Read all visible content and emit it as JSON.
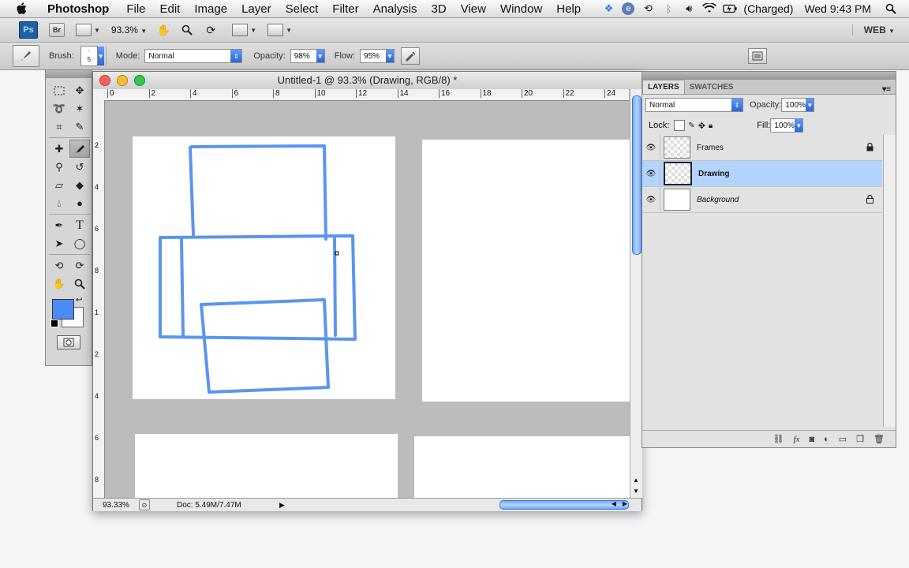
{
  "menubar": {
    "app_name": "Photoshop",
    "items": [
      "File",
      "Edit",
      "Image",
      "Layer",
      "Select",
      "Filter",
      "Analysis",
      "3D",
      "View",
      "Window",
      "Help"
    ],
    "battery": "(Charged)",
    "clock": "Wed 9:43 PM"
  },
  "appbar": {
    "ps_label": "Ps",
    "br_label": "Br",
    "zoom": "93.3%",
    "workspace": "WEB"
  },
  "options": {
    "brush_label": "Brush:",
    "brush_size": "5",
    "mode_label": "Mode:",
    "mode_value": "Normal",
    "opacity_label": "Opacity:",
    "opacity_value": "98%",
    "flow_label": "Flow:",
    "flow_value": "95%"
  },
  "tools": {
    "foreground_color": "#4a8cfa",
    "background_color": "#ffffff"
  },
  "document": {
    "title": "Untitled-1 @ 93.3% (Drawing, RGB/8) *",
    "ruler_h": [
      "0",
      "2",
      "4",
      "6",
      "8",
      "10",
      "12",
      "14",
      "16",
      "18",
      "20",
      "22",
      "24"
    ],
    "ruler_v": [
      "2",
      "4",
      "6",
      "8",
      "1",
      "2",
      "4",
      "6",
      "8"
    ],
    "status_zoom": "93.33%",
    "status_doc": "Doc: 5.49M/7.47M",
    "stroke_color": "#5b95ee"
  },
  "layers_panel": {
    "tabs": [
      "LAYERS",
      "SWATCHES"
    ],
    "blend_mode": "Normal",
    "opacity_label": "Opacity:",
    "opacity_value": "100%",
    "lock_label": "Lock:",
    "fill_label": "Fill:",
    "fill_value": "100%",
    "layers": [
      {
        "name": "Frames",
        "locked": true,
        "selected": false
      },
      {
        "name": "Drawing",
        "locked": false,
        "selected": true
      },
      {
        "name": "Background",
        "locked": true,
        "selected": false
      }
    ],
    "selection_color": "#b3d4ff"
  }
}
